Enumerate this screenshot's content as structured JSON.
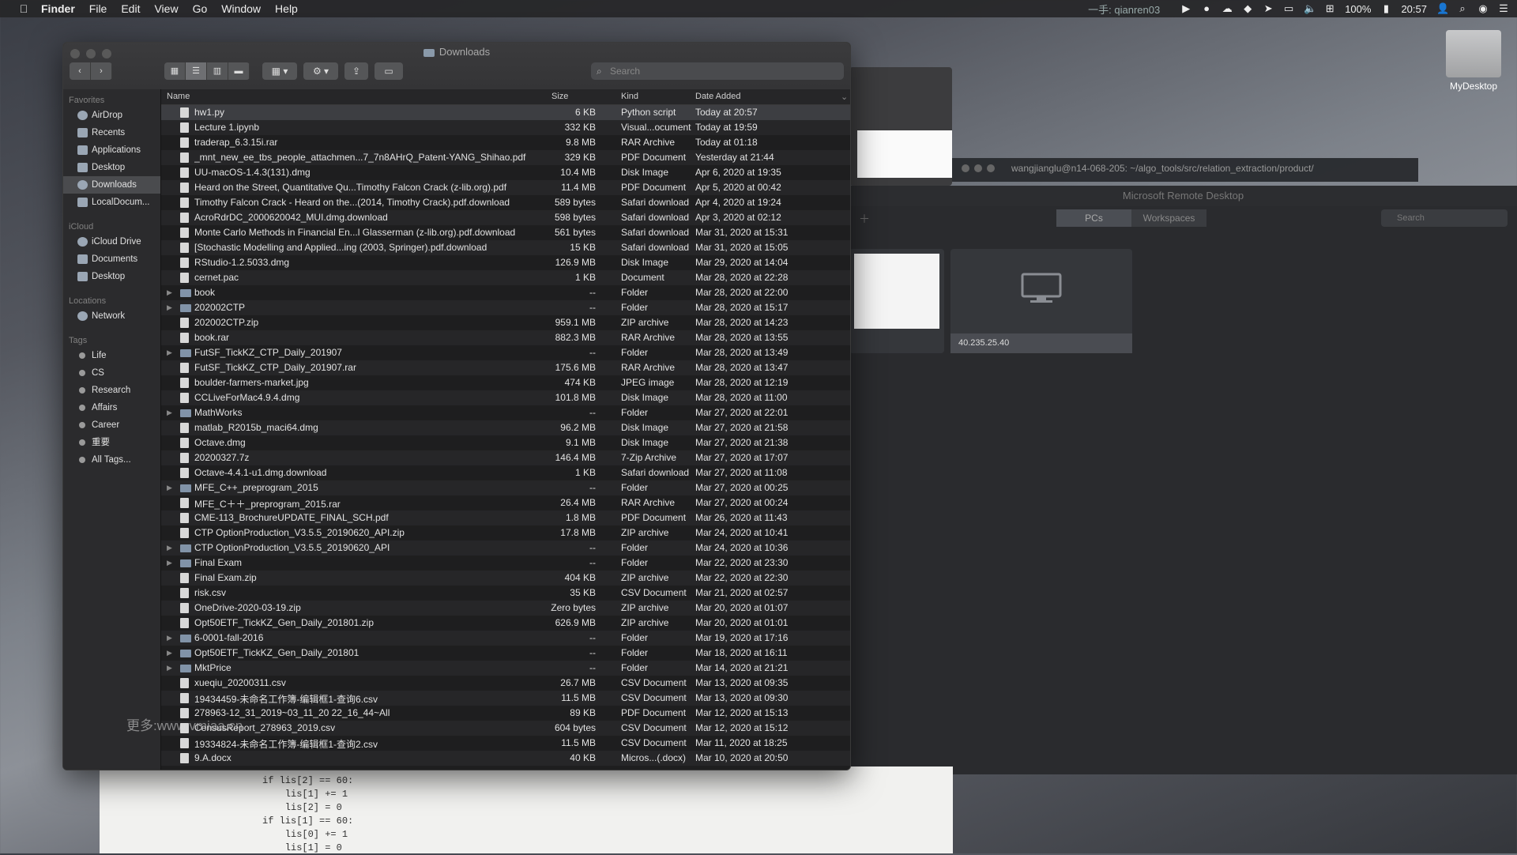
{
  "menubar": {
    "app_name": "Finder",
    "menus": [
      "File",
      "Edit",
      "View",
      "Go",
      "Window",
      "Help"
    ],
    "user_label": "一手: qianren03",
    "battery": "100%",
    "clock": "20:57"
  },
  "desktop": {
    "icon_label": "MyDesktop",
    "watermark": "更多:www.vmiaa.cn"
  },
  "code_window": {
    "code": "if lis[2] == 60:\n    lis[1] += 1\n    lis[2] = 0\nif lis[1] == 60:\n    lis[0] += 1\n    lis[1] = 0"
  },
  "terminal": {
    "title": "wangjianglu@n14-068-205: ~/algo_tools/src/relation_extraction/product/"
  },
  "rdp": {
    "title": "Microsoft Remote Desktop",
    "tabs": [
      "PCs",
      "Workspaces"
    ],
    "search_placeholder": "Search",
    "pc_label": "40.235.25.40"
  },
  "finder": {
    "title": "Downloads",
    "search_placeholder": "Search",
    "sidebar": {
      "favorites_header": "Favorites",
      "favorites": [
        "AirDrop",
        "Recents",
        "Applications",
        "Desktop",
        "Downloads",
        "LocalDocum..."
      ],
      "icloud_header": "iCloud",
      "icloud": [
        "iCloud Drive",
        "Documents",
        "Desktop"
      ],
      "locations_header": "Locations",
      "locations": [
        "Network"
      ],
      "tags_header": "Tags",
      "tags": [
        "Life",
        "CS",
        "Research",
        "Affairs",
        "Career",
        "重要",
        "All Tags..."
      ]
    },
    "columns": {
      "name": "Name",
      "size": "Size",
      "kind": "Kind",
      "date": "Date Added"
    },
    "files": [
      {
        "name": "hw1.py",
        "size": "6 KB",
        "kind": "Python script",
        "date": "Today at 20:57",
        "folder": false
      },
      {
        "name": "Lecture 1.ipynb",
        "size": "332 KB",
        "kind": "Visual...ocument",
        "date": "Today at 19:59",
        "folder": false
      },
      {
        "name": "traderap_6.3.15i.rar",
        "size": "9.8 MB",
        "kind": "RAR Archive",
        "date": "Today at 01:18",
        "folder": false
      },
      {
        "name": "_mnt_new_ee_tbs_people_attachmen...7_7n8AHrQ_Patent-YANG_Shihao.pdf",
        "size": "329 KB",
        "kind": "PDF Document",
        "date": "Yesterday at 21:44",
        "folder": false
      },
      {
        "name": "UU-macOS-1.4.3(131).dmg",
        "size": "10.4 MB",
        "kind": "Disk Image",
        "date": "Apr 6, 2020 at 19:35",
        "folder": false
      },
      {
        "name": "Heard on the Street, Quantitative Qu...Timothy Falcon Crack (z-lib.org).pdf",
        "size": "11.4 MB",
        "kind": "PDF Document",
        "date": "Apr 5, 2020 at 00:42",
        "folder": false
      },
      {
        "name": "Timothy Falcon Crack - Heard on the...(2014, Timothy Crack).pdf.download",
        "size": "589 bytes",
        "kind": "Safari download",
        "date": "Apr 4, 2020 at 19:24",
        "folder": false
      },
      {
        "name": "AcroRdrDC_2000620042_MUI.dmg.download",
        "size": "598 bytes",
        "kind": "Safari download",
        "date": "Apr 3, 2020 at 02:12",
        "folder": false
      },
      {
        "name": "Monte Carlo Methods in Financial En...l Glasserman (z-lib.org).pdf.download",
        "size": "561 bytes",
        "kind": "Safari download",
        "date": "Mar 31, 2020 at 15:31",
        "folder": false
      },
      {
        "name": "[Stochastic Modelling and Applied...ing (2003, Springer).pdf.download",
        "size": "15 KB",
        "kind": "Safari download",
        "date": "Mar 31, 2020 at 15:05",
        "folder": false
      },
      {
        "name": "RStudio-1.2.5033.dmg",
        "size": "126.9 MB",
        "kind": "Disk Image",
        "date": "Mar 29, 2020 at 14:04",
        "folder": false
      },
      {
        "name": "cernet.pac",
        "size": "1 KB",
        "kind": "Document",
        "date": "Mar 28, 2020 at 22:28",
        "folder": false
      },
      {
        "name": "book",
        "size": "--",
        "kind": "Folder",
        "date": "Mar 28, 2020 at 22:00",
        "folder": true
      },
      {
        "name": "202002CTP",
        "size": "--",
        "kind": "Folder",
        "date": "Mar 28, 2020 at 15:17",
        "folder": true
      },
      {
        "name": "202002CTP.zip",
        "size": "959.1 MB",
        "kind": "ZIP archive",
        "date": "Mar 28, 2020 at 14:23",
        "folder": false
      },
      {
        "name": "book.rar",
        "size": "882.3 MB",
        "kind": "RAR Archive",
        "date": "Mar 28, 2020 at 13:55",
        "folder": false
      },
      {
        "name": "FutSF_TickKZ_CTP_Daily_201907",
        "size": "--",
        "kind": "Folder",
        "date": "Mar 28, 2020 at 13:49",
        "folder": true
      },
      {
        "name": "FutSF_TickKZ_CTP_Daily_201907.rar",
        "size": "175.6 MB",
        "kind": "RAR Archive",
        "date": "Mar 28, 2020 at 13:47",
        "folder": false
      },
      {
        "name": "boulder-farmers-market.jpg",
        "size": "474 KB",
        "kind": "JPEG image",
        "date": "Mar 28, 2020 at 12:19",
        "folder": false
      },
      {
        "name": "CCLiveForMac4.9.4.dmg",
        "size": "101.8 MB",
        "kind": "Disk Image",
        "date": "Mar 28, 2020 at 11:00",
        "folder": false
      },
      {
        "name": "MathWorks",
        "size": "--",
        "kind": "Folder",
        "date": "Mar 27, 2020 at 22:01",
        "folder": true
      },
      {
        "name": "matlab_R2015b_maci64.dmg",
        "size": "96.2 MB",
        "kind": "Disk Image",
        "date": "Mar 27, 2020 at 21:58",
        "folder": false
      },
      {
        "name": "Octave.dmg",
        "size": "9.1 MB",
        "kind": "Disk Image",
        "date": "Mar 27, 2020 at 21:38",
        "folder": false
      },
      {
        "name": "20200327.7z",
        "size": "146.4 MB",
        "kind": "7-Zip Archive",
        "date": "Mar 27, 2020 at 17:07",
        "folder": false
      },
      {
        "name": "Octave-4.4.1-u1.dmg.download",
        "size": "1 KB",
        "kind": "Safari download",
        "date": "Mar 27, 2020 at 11:08",
        "folder": false
      },
      {
        "name": "MFE_C++_preprogram_2015",
        "size": "--",
        "kind": "Folder",
        "date": "Mar 27, 2020 at 00:25",
        "folder": true
      },
      {
        "name": "MFE_C＋＋_preprogram_2015.rar",
        "size": "26.4 MB",
        "kind": "RAR Archive",
        "date": "Mar 27, 2020 at 00:24",
        "folder": false
      },
      {
        "name": "CME-113_BrochureUPDATE_FINAL_SCH.pdf",
        "size": "1.8 MB",
        "kind": "PDF Document",
        "date": "Mar 26, 2020 at 11:43",
        "folder": false
      },
      {
        "name": "CTP OptionProduction_V3.5.5_20190620_API.zip",
        "size": "17.8 MB",
        "kind": "ZIP archive",
        "date": "Mar 24, 2020 at 10:41",
        "folder": false
      },
      {
        "name": "CTP OptionProduction_V3.5.5_20190620_API",
        "size": "--",
        "kind": "Folder",
        "date": "Mar 24, 2020 at 10:36",
        "folder": true
      },
      {
        "name": "Final Exam",
        "size": "--",
        "kind": "Folder",
        "date": "Mar 22, 2020 at 23:30",
        "folder": true
      },
      {
        "name": "Final Exam.zip",
        "size": "404 KB",
        "kind": "ZIP archive",
        "date": "Mar 22, 2020 at 22:30",
        "folder": false
      },
      {
        "name": "risk.csv",
        "size": "35 KB",
        "kind": "CSV Document",
        "date": "Mar 21, 2020 at 02:57",
        "folder": false
      },
      {
        "name": "OneDrive-2020-03-19.zip",
        "size": "Zero bytes",
        "kind": "ZIP archive",
        "date": "Mar 20, 2020 at 01:07",
        "folder": false
      },
      {
        "name": "Opt50ETF_TickKZ_Gen_Daily_201801.zip",
        "size": "626.9 MB",
        "kind": "ZIP archive",
        "date": "Mar 20, 2020 at 01:01",
        "folder": false
      },
      {
        "name": "6-0001-fall-2016",
        "size": "--",
        "kind": "Folder",
        "date": "Mar 19, 2020 at 17:16",
        "folder": true
      },
      {
        "name": "Opt50ETF_TickKZ_Gen_Daily_201801",
        "size": "--",
        "kind": "Folder",
        "date": "Mar 18, 2020 at 16:11",
        "folder": true
      },
      {
        "name": "MktPrice",
        "size": "--",
        "kind": "Folder",
        "date": "Mar 14, 2020 at 21:21",
        "folder": true
      },
      {
        "name": "xueqiu_20200311.csv",
        "size": "26.7 MB",
        "kind": "CSV Document",
        "date": "Mar 13, 2020 at 09:35",
        "folder": false
      },
      {
        "name": "19434459-未命名工作簿-编辑框1-查询6.csv",
        "size": "11.5 MB",
        "kind": "CSV Document",
        "date": "Mar 13, 2020 at 09:30",
        "folder": false
      },
      {
        "name": "278963-12_31_2019~03_11_20 22_16_44~All",
        "size": "89 KB",
        "kind": "PDF Document",
        "date": "Mar 12, 2020 at 15:13",
        "folder": false
      },
      {
        "name": "CensusReport_278963_2019.csv",
        "size": "604 bytes",
        "kind": "CSV Document",
        "date": "Mar 12, 2020 at 15:12",
        "folder": false
      },
      {
        "name": "19334824-未命名工作簿-编辑框1-查询2.csv",
        "size": "11.5 MB",
        "kind": "CSV Document",
        "date": "Mar 11, 2020 at 18:25",
        "folder": false
      },
      {
        "name": "9.A.docx",
        "size": "40 KB",
        "kind": "Micros...(.docx)",
        "date": "Mar 10, 2020 at 20:50",
        "folder": false
      }
    ]
  }
}
